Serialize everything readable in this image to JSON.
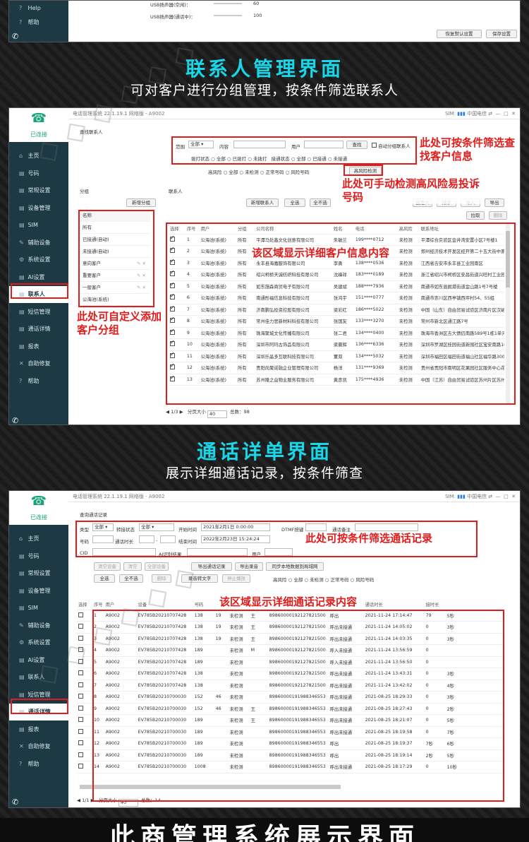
{
  "top_window": {
    "side": [
      {
        "icon": "?",
        "label": "Help"
      },
      {
        "icon": "?",
        "label": "帮助"
      }
    ],
    "labels": [
      "USB扬声器(空闲)：",
      "USB扬声器(通话中)："
    ],
    "values": [
      "60",
      "100"
    ],
    "buttons": [
      "恢复默认设置",
      "保存设置"
    ]
  },
  "section1": {
    "title": "联系人管理界面",
    "subtitle": "可对客户进行分组管理，按条件筛选联系人"
  },
  "section2": {
    "title": "通话详单界面",
    "subtitle": "展示详细通话记录，按条件筛查"
  },
  "bottom_title": "此商管理系统展示界面",
  "app": {
    "connected": "已连接",
    "title": "电话管理系统  22.1.19.1  网络版 - A9002",
    "sim_label": "SIM:",
    "carrier": "中国电信"
  },
  "nav": [
    {
      "icon": "⌂",
      "label": "主页"
    },
    {
      "icon": "▤",
      "label": "号码"
    },
    {
      "icon": "▤",
      "label": "常规设置"
    },
    {
      "icon": "▤",
      "label": "设备管理"
    },
    {
      "icon": "▤",
      "label": "SIM"
    },
    {
      "icon": "✎",
      "label": "辅助设备"
    },
    {
      "icon": "⚙",
      "label": "系统设置"
    },
    {
      "icon": "▤",
      "label": "AI设置"
    },
    {
      "icon": "▤",
      "label": "联系人"
    },
    {
      "icon": "▤",
      "label": "短信管理"
    },
    {
      "icon": "▤",
      "label": "通话详情"
    },
    {
      "icon": "▤",
      "label": "报表"
    },
    {
      "icon": "✕",
      "label": "自助修复"
    },
    {
      "icon": "?",
      "label": "帮助"
    }
  ],
  "contacts": {
    "search_group": "查找联系人",
    "range_label": "范围",
    "range_value": "全部",
    "content_label": "内容",
    "user_label": "用户",
    "find_btn": "查找",
    "auto_group": "自动分组联系人",
    "dial_status": "拨打状态",
    "dial_opts": [
      "全部",
      "已拨打",
      "未拨打"
    ],
    "conn_status": "接通状态",
    "conn_opts": [
      "全部",
      "已接通",
      "未接通"
    ],
    "risk_label": "高风险",
    "risk_opts": [
      "全部",
      "未检测",
      "正常号码",
      "风险号码"
    ],
    "risk_btn": "高风险检测",
    "group_title": "分组",
    "new_group_btn": "新增分组",
    "group_header": "名称",
    "groups": [
      "所有",
      "已接通(自动)",
      "未接通(自动)",
      "意向客户",
      "重要客户",
      "一般客户",
      "公海池(系统)"
    ],
    "contact_title": "联系人",
    "buttons": [
      "新增联系人",
      "全选",
      "全不选",
      "自定义",
      "排序",
      "导入",
      "导出"
    ],
    "buttons2": [
      "拉取",
      "删除"
    ],
    "columns": [
      "选择",
      "序号",
      "用户",
      "分组",
      "公司名称",
      "姓名",
      "电话",
      "高风险",
      "联系地址"
    ],
    "rows": [
      [
        "1",
        "公海池(系统)",
        "所有",
        "平潭马处鑫文化创意有限公司",
        "朱敏兰",
        "199****0712",
        "未检测",
        "平潭综合实验区金井湾安置小区7号楼1"
      ],
      [
        "2",
        "公海池(系统)",
        "所有",
        "郑州花旗家居用品有限公司",
        "王春",
        "136****3186",
        "未检测",
        "郑州经济技术开发区经开第二十五大街中原国际物流港航海路19号智慧谷B1-1"
      ],
      [
        "3",
        "公海池(系统)",
        "所有",
        "永丰县海嘉服饰有限公司",
        "李勇",
        "138****0536",
        "未检测",
        "江西省吉安市永丰县工业园南区"
      ],
      [
        "4",
        "公海池(系统)",
        "所有",
        "绍兴柯桥天诚纺织科技有限公司",
        "沈峰祥",
        "183****0189",
        "未检测",
        "浙江省绍兴市柯桥区安昌街道兴旺村工业园区316号（承诺申报）"
      ],
      [
        "5",
        "公海池(系统)",
        "所有",
        "如东施森商贸电子有限公司",
        "吴建斌",
        "188****7936",
        "未检测",
        "南通市如东县掘港街道金山路1号7号楼"
      ],
      [
        "6",
        "公海池(系统)",
        "所有",
        "南通彤福信息科技有限公司",
        "张鸿宇",
        "151****0777",
        "未检测",
        "南通市崇川区西亭镇西坪村54、55组"
      ],
      [
        "7",
        "公海池(系统)",
        "所有",
        "济南鹏弘投资控股有限公司",
        "梁彩红",
        "186****5022",
        "未检测",
        "中国（山东）自由贸易试验区济南片区汉峪金融商务中心"
      ],
      [
        "8",
        "公海池(系统)",
        "所有",
        "常州佳力思新材料科技有限公司",
        "张国友",
        "133****3270",
        "未检测",
        "常州市新北区通江路7号"
      ],
      [
        "9",
        "公海池(系统)",
        "所有",
        "珠海聚城文化传播有限公司",
        "张二君",
        "134****0400",
        "未检测",
        "珠海市香洲区吉大情侣南路589号1栋1单元1302房"
      ],
      [
        "10",
        "公海池(系统)",
        "所有",
        "深圳市阿玛古饰品有限公司",
        "梁晨辉",
        "136****6336",
        "未检测",
        "深圳市罗湖区桂园街道新围社区宝安南路1001号"
      ],
      [
        "11",
        "公海池(系统)",
        "所有",
        "深圳乐晶多互联科技有限公司",
        "董双",
        "134****5032",
        "未检测",
        "深圳市福田区福田街道福山社区福华路3007号"
      ],
      [
        "12",
        "公海池(系统)",
        "所有",
        "贵阳尚聚诺融企业管理有限公司",
        "杨洋",
        "131****9369",
        "未检测",
        "贵州省贵阳市南明区花果园社区服务中心花果园二期"
      ],
      [
        "13",
        "公海池(系统)",
        "所有",
        "苏州隆之益物业服务有限公司",
        "黄彦凯",
        "175****4936",
        "未检测",
        "中国（江苏）自由贸易试验区苏州片区苏州工业园区"
      ]
    ],
    "page": "1/3",
    "page_size_label": "分页大小",
    "page_size": "40",
    "total_label": "总数：",
    "total": "98"
  },
  "anno1": {
    "a": "此处可按条件筛选查找客户信息",
    "b": "此处可手动检测高风险易投诉号码",
    "c": "该区域显示详细客户信息内容",
    "d": "此处可自定义添加客户分组"
  },
  "calls": {
    "group": "查询通话记录",
    "type_label": "类型",
    "type_value": "全部",
    "transfer_label": "转接状态",
    "transfer_value": "全部",
    "start_label": "开始时间",
    "start_value": "2021年2月1日 0:00:00",
    "dtmf_label": "DTMF按键",
    "note_label": "通话备注",
    "num_label": "号码",
    "dur_label": "通话时长",
    "end_label": "结束时间",
    "end_value": "2022年2月23日 15:24:24",
    "cid_label": "CID",
    "ai_label": "AI识别结果",
    "user_label": "用户",
    "btn_row1": [
      "清空设备",
      "清空",
      "全部设备",
      "导出通话记录",
      "导出录音",
      "同步本地数据到局域网"
    ],
    "btn_row2": [
      "全选",
      "全不选",
      "删除",
      "录音转文字",
      "停止播放"
    ],
    "risk_label": "高风险",
    "risk_opts": [
      "全部",
      "未检测",
      "正常号码",
      "风险号码"
    ],
    "columns": [
      "选择",
      "序号",
      "用户",
      "设备",
      "号码",
      "",
      "",
      "",
      "接通时间",
      "",
      "通话时长",
      "接时长"
    ],
    "rows": [
      [
        "1",
        "A9002",
        "EV785B20210707428",
        "138",
        "19",
        "未检测",
        "王",
        "89860000192127821500",
        "呼出",
        "2021-11-24 17:14:47",
        "79",
        "5秒"
      ],
      [
        "2",
        "A9002",
        "EV785B20210707428",
        "138",
        "19",
        "未检测",
        "王",
        "89860000192127821500",
        "呼出未接通",
        "2021-11-24 14:05:02",
        "0",
        "3秒"
      ],
      [
        "3",
        "A9002",
        "EV785B20210707428",
        "138",
        "19",
        "未检测",
        "王",
        "89860000192127821500",
        "呼出未接通",
        "2021-11-24 14:03:35",
        "0",
        "3秒"
      ],
      [
        "4",
        "A9002",
        "EV785B20210707428",
        "189",
        "",
        "未检测",
        "M",
        "89860000192127821500",
        "呼入未接通",
        "2021-11-24 13:56:59",
        "0",
        ""
      ],
      [
        "5",
        "A9002",
        "EV785B20210707428",
        "189",
        "",
        "未检测",
        "",
        "89860000192127821500",
        "呼入未接通",
        "2021-11-24 13:56:50",
        "0",
        ""
      ],
      [
        "6",
        "A9002",
        "EV785B20210707428",
        "138",
        "",
        "未检测",
        "",
        "89860000192127821500",
        "呼出未接通",
        "2021-11-24 13:43:31",
        "0",
        "3秒"
      ],
      [
        "7",
        "A9002",
        "EV785B20210707428",
        "138",
        "",
        "未检测",
        "",
        "89860000192127821500",
        "呼出未接通",
        "2021-11-24 13:42:02",
        "0",
        "4秒"
      ],
      [
        "8",
        "A9002",
        "EV785B20210700030",
        "152",
        "46",
        "未检测",
        "",
        "89860000191988346553",
        "呼出未接通",
        "2021-08-25 18:29:33",
        "0",
        "3秒"
      ],
      [
        "9",
        "A9002",
        "EV785B20210700030",
        "152",
        "46",
        "未检测",
        "王",
        "89860000191988346553",
        "呼出未接通",
        "2021-08-25 18:27:43",
        "0",
        "2秒"
      ],
      [
        "10",
        "A9002",
        "EV785B20210700030",
        "189",
        "",
        "未检测",
        "王",
        "89860000191988346553",
        "呼出未接通",
        "2021-08-25 18:21:07",
        "0",
        "5秒"
      ],
      [
        "11",
        "A9002",
        "EV785B20210700030",
        "189",
        "",
        "未检测",
        "",
        "89860000191988346553",
        "呼出未接通",
        "2021-08-25 18:19:58",
        "0",
        "7秒"
      ],
      [
        "12",
        "A9002",
        "EV785B20210700030",
        "189",
        "",
        "未检测",
        "",
        "89860000191988346553",
        "呼出",
        "2021-08-25 18:19:37",
        "7秒",
        "6秒"
      ],
      [
        "13",
        "A9002",
        "EV785B20210700030",
        "189",
        "",
        "未检测",
        "",
        "89860000191988346553",
        "呼出",
        "2021-08-25 18:19:14",
        "2秒",
        "5秒"
      ],
      [
        "14",
        "A9002",
        "EV785B20210700030",
        "1008",
        "",
        "未检测",
        "",
        "89860000191988346553",
        "呼出未接通",
        "2021-08-25 18:17:29",
        "0",
        "10秒"
      ]
    ],
    "page": "1/1",
    "page_size_label": "分页大小",
    "page_size": "40",
    "total_label": "总数：",
    "total": "14"
  },
  "anno2": {
    "a": "此处可按条件筛选通话记录",
    "b": "该区域显示详细通话记录内容"
  },
  "colors": {
    "accent": "#19d6e8",
    "annotation": "#e21b1b",
    "sidebar": "#1d3a44"
  }
}
